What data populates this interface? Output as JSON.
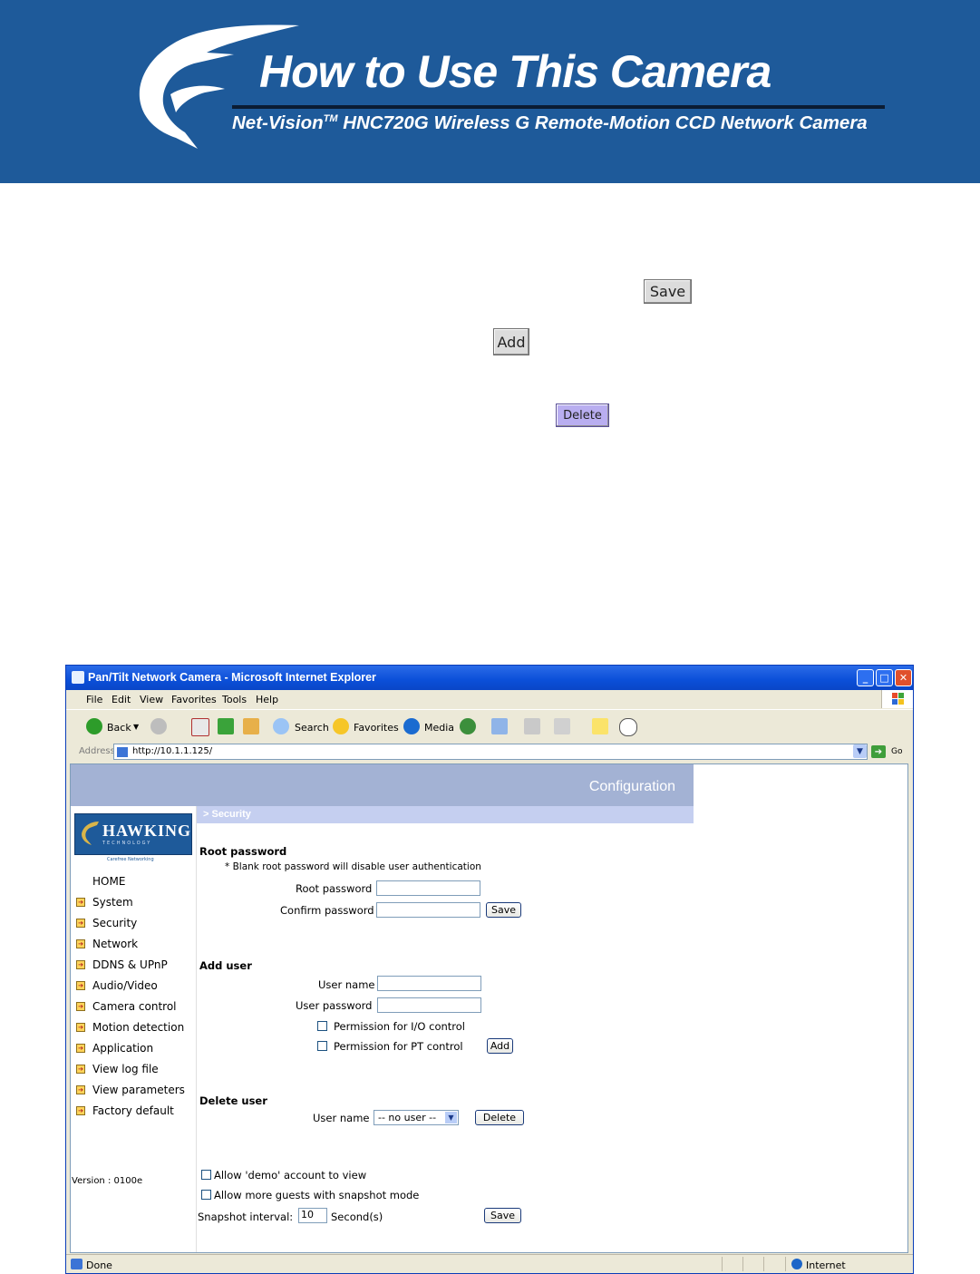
{
  "banner": {
    "title": "How to Use This Camera",
    "subtitle_pre": "Net-Vision",
    "subtitle_tm": "TM",
    "subtitle_post": " HNC720G Wireless G Remote-Motion CCD Network Camera",
    "bg_color": "#1e5a9a"
  },
  "sample_buttons": {
    "save": "Save",
    "add": "Add",
    "delete": "Delete"
  },
  "browser": {
    "title": "Pan/Tilt Network Camera - Microsoft Internet Explorer",
    "menu": [
      "File",
      "Edit",
      "View",
      "Favorites",
      "Tools",
      "Help"
    ],
    "toolbar": {
      "back": "Back",
      "search": "Search",
      "favorites": "Favorites",
      "media": "Media"
    },
    "address_label": "Address",
    "address_url": "http://10.1.1.125/",
    "go_label": "Go",
    "status_text": "Done",
    "status_zone": "Internet"
  },
  "camera_page": {
    "header": "Configuration",
    "section": "> Security",
    "logo_text": "HAWKING",
    "logo_sub": "TECHNOLOGY",
    "logo_tag": "Carefree Networking",
    "nav": [
      "HOME",
      "System",
      "Security",
      "Network",
      "DDNS & UPnP",
      "Audio/Video",
      "Camera control",
      "Motion detection",
      "Application",
      "View log file",
      "View parameters",
      "Factory default"
    ],
    "version": "Version : 0100e",
    "root": {
      "heading": "Root password",
      "note": "* Blank root password will disable user authentication",
      "root_label": "Root password",
      "confirm_label": "Confirm password",
      "save": "Save"
    },
    "add_user": {
      "heading": "Add user",
      "name_label": "User name",
      "pass_label": "User password",
      "perm_io": "Permission for I/O control",
      "perm_pt": "Permission for PT control",
      "add": "Add"
    },
    "delete_user": {
      "heading": "Delete user",
      "name_label": "User name",
      "selected": "-- no user --",
      "delete": "Delete"
    },
    "options": {
      "demo": "Allow 'demo' account to view",
      "guests": "Allow more guests with snapshot mode",
      "snapshot_label": "Snapshot interval:",
      "snapshot_value": "10",
      "snapshot_unit": "Second(s)",
      "save": "Save"
    }
  }
}
